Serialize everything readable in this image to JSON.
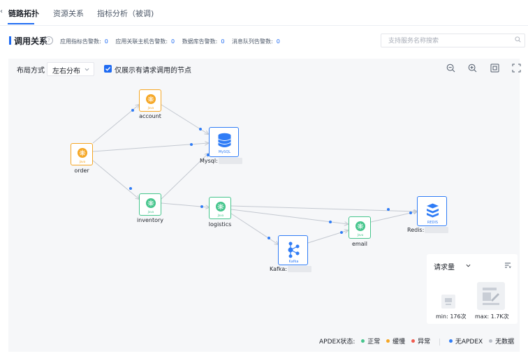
{
  "tabs": [
    {
      "label": "链路拓扑",
      "active": true
    },
    {
      "label": "资源关系",
      "active": false
    },
    {
      "label": "指标分析（被调)",
      "active": false
    }
  ],
  "section": {
    "title": "调用关系",
    "stats": [
      {
        "label": "应用指标告警数:",
        "value": "0"
      },
      {
        "label": "应用关联主机告警数:",
        "value": "0"
      },
      {
        "label": "数据库告警数:",
        "value": "0"
      },
      {
        "label": "消息队列告警数:",
        "value": "0"
      }
    ]
  },
  "search": {
    "placeholder": "支持服务名称搜索",
    "value": ""
  },
  "toolbar": {
    "layout_label": "布局方式",
    "layout_value": "左右分布",
    "checkbox_label": "仅展示有请求调用的节点",
    "checkbox_checked": true
  },
  "nodes": {
    "order": {
      "label": "order",
      "type": "Java"
    },
    "account": {
      "label": "account",
      "type": "Java"
    },
    "inventory": {
      "label": "inventory",
      "type": "Java"
    },
    "logistics": {
      "label": "logistics",
      "type": "Java"
    },
    "email": {
      "label": "email",
      "type": "Java"
    },
    "mysql": {
      "label": "Mysql:",
      "badge": "MySQL"
    },
    "redis": {
      "label": "Redis:",
      "badge": "REDIS"
    },
    "kafka": {
      "label": "Kafka:",
      "badge": "Kafka"
    }
  },
  "metric": {
    "title": "请求量",
    "min_label": "min: 176次",
    "max_label": "max: 1.7K次"
  },
  "legend": {
    "prefix": "APDEX状态:",
    "items": [
      {
        "label": "正常",
        "color": "#45c58c"
      },
      {
        "label": "缓慢",
        "color": "#f5a623"
      },
      {
        "label": "异常",
        "color": "#f05b4f"
      },
      {
        "label": "无APDEX",
        "color": "#2f7cf6"
      },
      {
        "label": "无数据",
        "color": "#b9bec7"
      }
    ]
  },
  "colors": {
    "accent": "#1f6bf2",
    "java_orange": "#f5a623",
    "java_green": "#45c58c",
    "infra_blue": "#2f7cf6"
  }
}
